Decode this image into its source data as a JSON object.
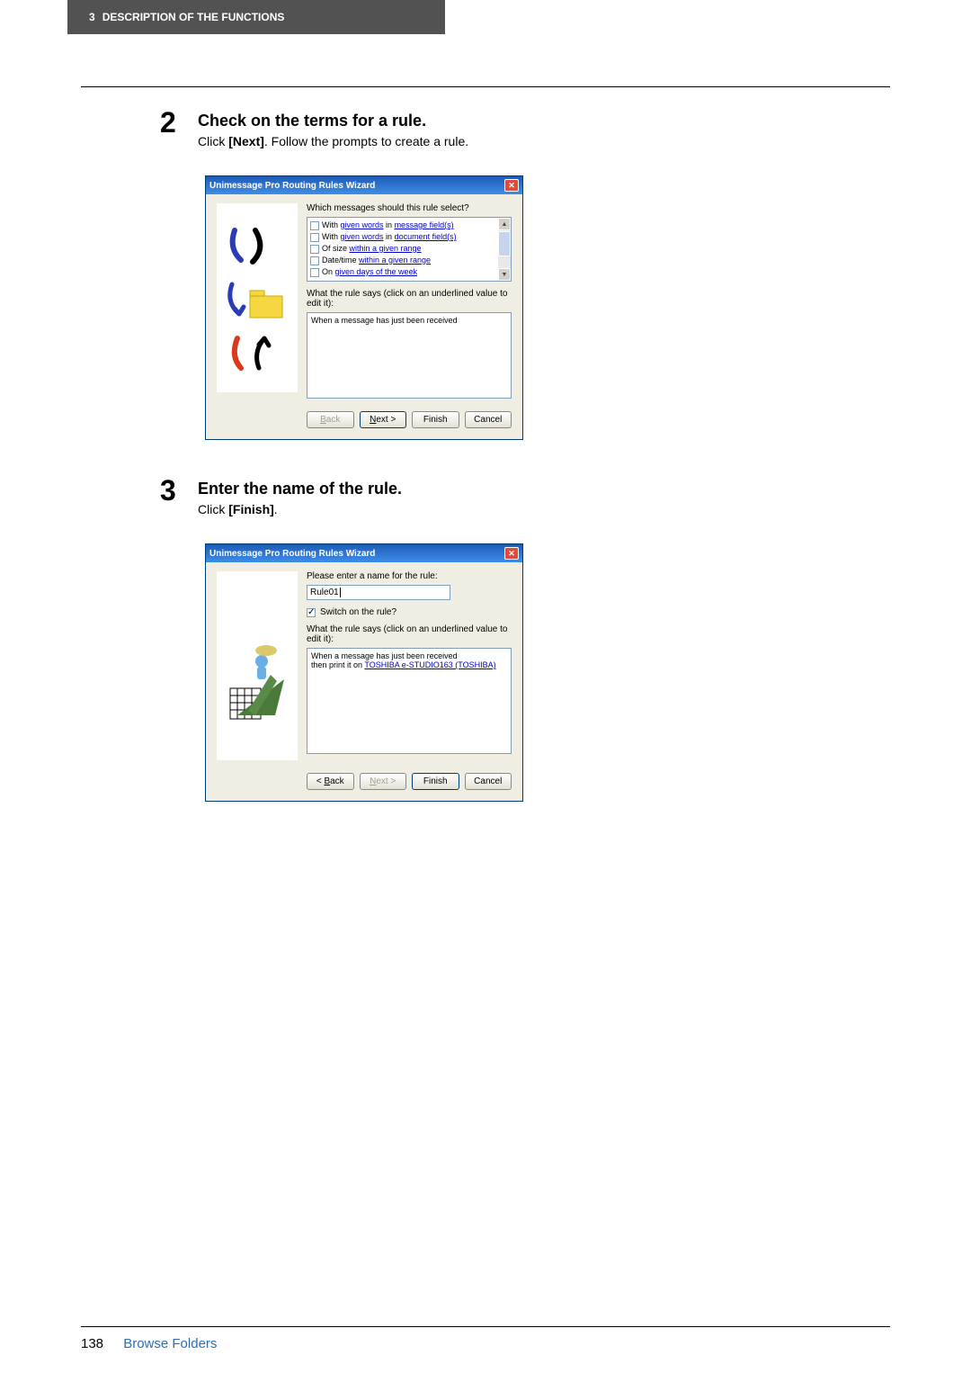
{
  "header": {
    "chapter_num": "3",
    "chapter_title": "DESCRIPTION OF THE FUNCTIONS"
  },
  "step2": {
    "num": "2",
    "title": "Check on the terms for a rule.",
    "desc_pre": "Click ",
    "desc_bold": "[Next]",
    "desc_post": ". Follow the prompts to create a rule."
  },
  "step3": {
    "num": "3",
    "title": "Enter the name of the rule.",
    "desc_pre": "Click ",
    "desc_bold": "[Finish]",
    "desc_post": "."
  },
  "dialog1": {
    "title": "Unimessage Pro Routing Rules Wizard",
    "question": "Which messages should this rule select?",
    "options": [
      {
        "pre": "With ",
        "link1": "given words",
        "mid": " in ",
        "link2": "message field(s)"
      },
      {
        "pre": "With ",
        "link1": "given words",
        "mid": " in ",
        "link2": "document field(s)"
      },
      {
        "pre": "Of size ",
        "link1": "within a given range",
        "mid": "",
        "link2": ""
      },
      {
        "pre": "Date/time ",
        "link1": "within a given range",
        "mid": "",
        "link2": ""
      },
      {
        "pre": "On ",
        "link1": "given days of the week",
        "mid": "",
        "link2": ""
      }
    ],
    "rule_label": "What the rule says (click on an underlined value to edit it):",
    "rule_text": "When a message has just been received",
    "buttons": {
      "back": "< Back",
      "next": "Next >",
      "finish": "Finish",
      "cancel": "Cancel"
    }
  },
  "dialog2": {
    "title": "Unimessage Pro Routing Rules Wizard",
    "name_label": "Please enter a name for the rule:",
    "name_value": "Rule01",
    "switch_label": "Switch on the rule?",
    "rule_label": "What the rule says (click on an underlined value to edit it):",
    "rule_line1": "When a message has just been received",
    "rule_line2_pre": "then print it on ",
    "rule_line2_link": "TOSHIBA e-STUDIO163 (TOSHIBA)",
    "buttons": {
      "back": "< Back",
      "next": "Next >",
      "finish": "Finish",
      "cancel": "Cancel"
    }
  },
  "footer": {
    "page": "138",
    "section": "Browse Folders"
  }
}
